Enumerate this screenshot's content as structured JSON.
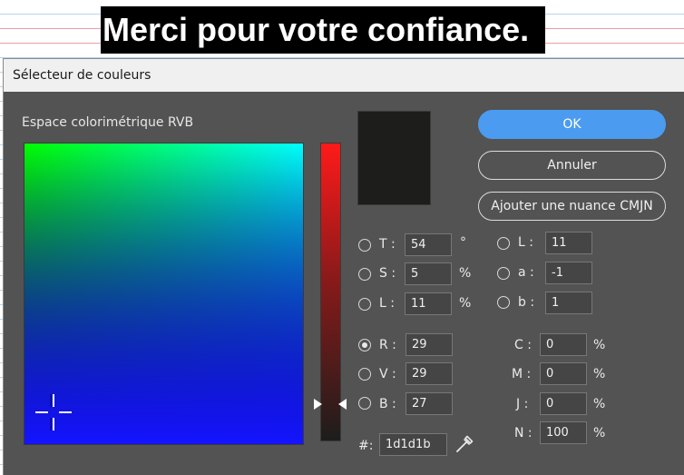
{
  "document": {
    "banner_text": "Merci pour votre confiance."
  },
  "dialog": {
    "title": "Sélecteur de couleurs",
    "color_space_label": "Espace colorimétrique RVB",
    "current_color": "#1d1d1b",
    "buttons": {
      "ok": "OK",
      "cancel": "Annuler",
      "add_cmyk": "Ajouter une nuance CMJN"
    },
    "hsl": {
      "h": {
        "label": "T :",
        "value": "54",
        "unit": "°"
      },
      "s": {
        "label": "S :",
        "value": "5",
        "unit": "%"
      },
      "l": {
        "label": "L :",
        "value": "11",
        "unit": "%"
      }
    },
    "lab": {
      "l": {
        "label": "L :",
        "value": "11"
      },
      "a": {
        "label": "a :",
        "value": "-1"
      },
      "b": {
        "label": "b :",
        "value": "1"
      }
    },
    "rgb": {
      "r": {
        "label": "R :",
        "value": "29",
        "selected": true
      },
      "g": {
        "label": "V :",
        "value": "29"
      },
      "b": {
        "label": "B :",
        "value": "27"
      }
    },
    "cmyk": {
      "c": {
        "label": "C :",
        "value": "0",
        "unit": "%"
      },
      "m": {
        "label": "M :",
        "value": "0",
        "unit": "%"
      },
      "y": {
        "label": "J :",
        "value": "0",
        "unit": "%"
      },
      "k": {
        "label": "N :",
        "value": "100",
        "unit": "%"
      }
    },
    "hex": {
      "label": "#:",
      "value": "1d1d1b"
    },
    "eyedropper_icon": "eyedropper-icon"
  }
}
